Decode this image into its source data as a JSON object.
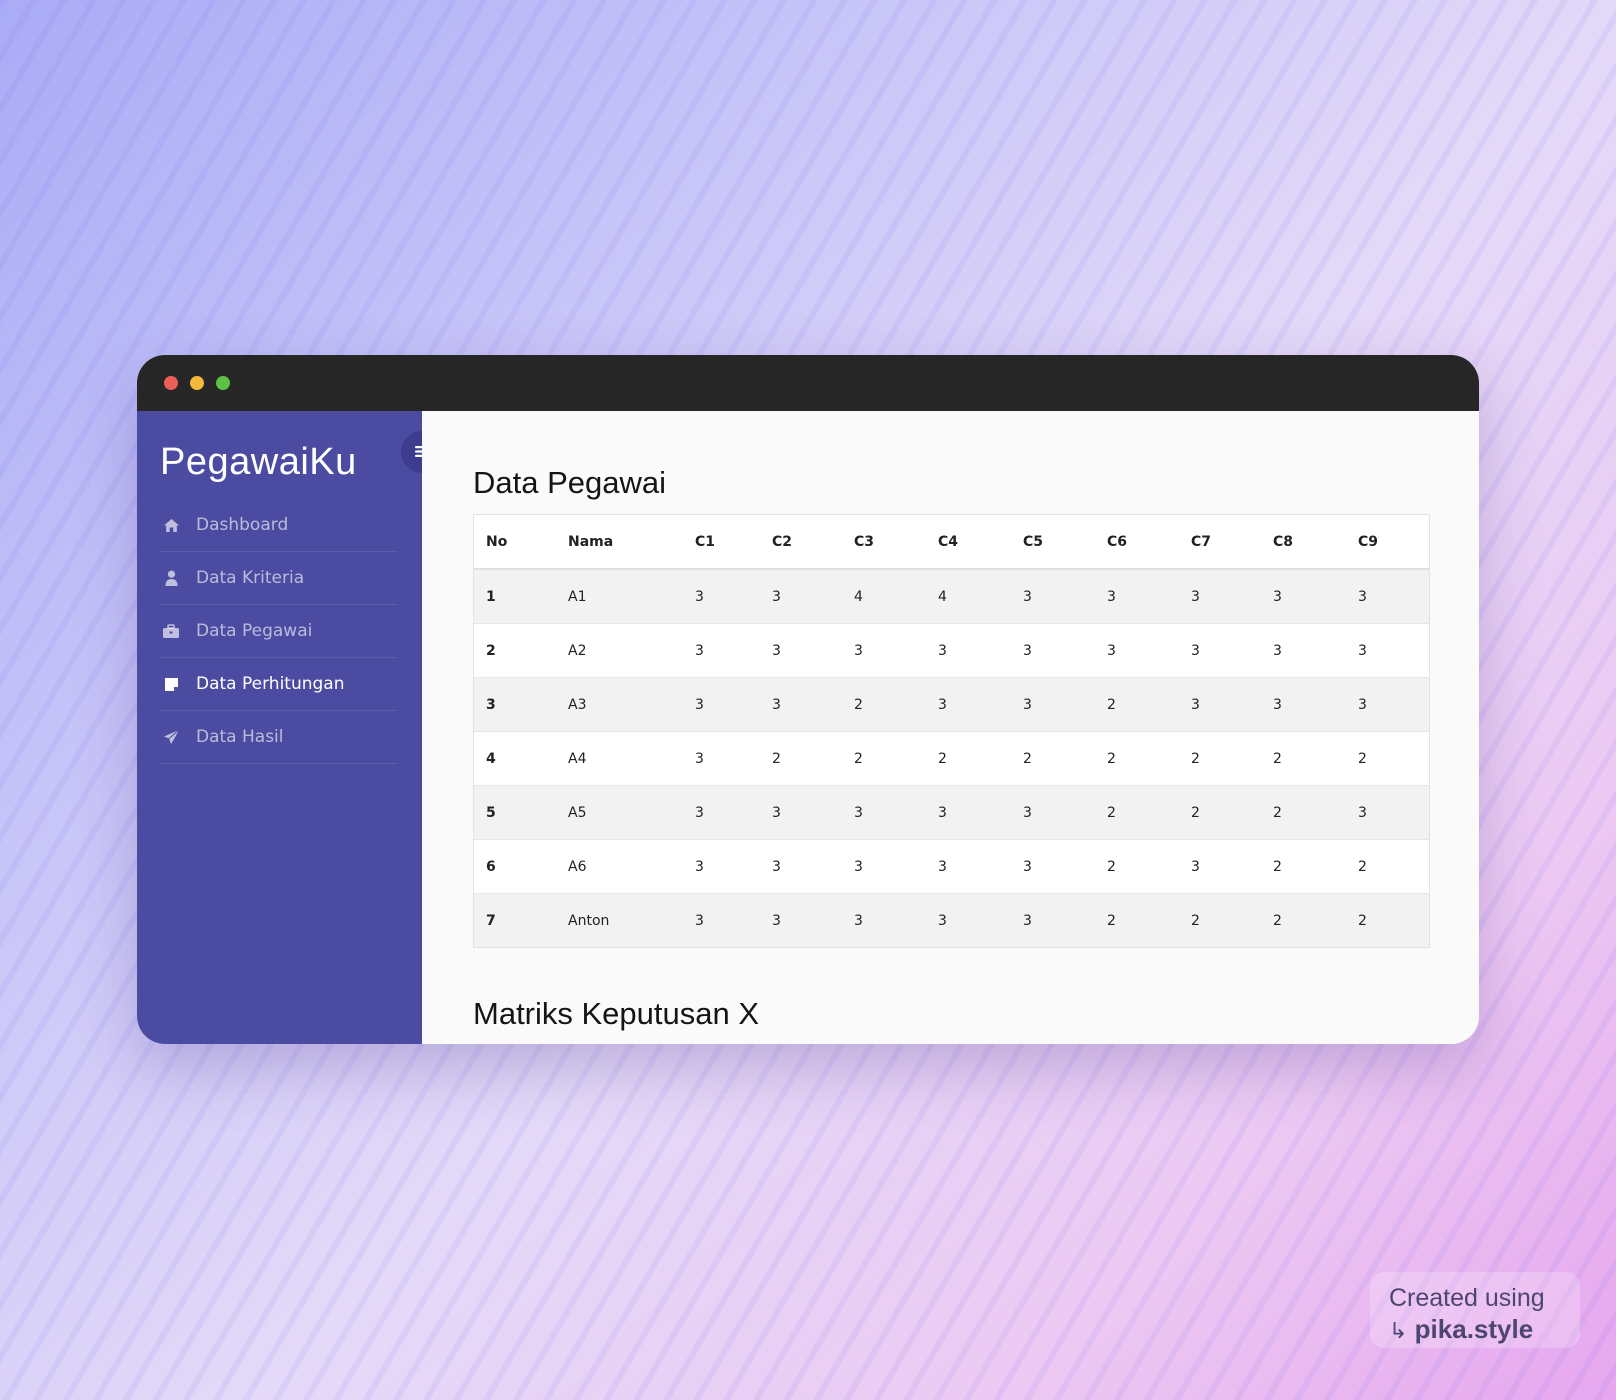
{
  "app": {
    "brand": "PegawaiKu"
  },
  "sidebar": {
    "items": [
      {
        "label": "Dashboard",
        "icon": "home-icon"
      },
      {
        "label": "Data Kriteria",
        "icon": "user-icon"
      },
      {
        "label": "Data Pegawai",
        "icon": "briefcase-icon"
      },
      {
        "label": "Data Perhitungan",
        "icon": "note-icon",
        "active": true
      },
      {
        "label": "Data Hasil",
        "icon": "paper-plane-icon"
      }
    ]
  },
  "main": {
    "section1_title": "Data Pegawai",
    "section2_title": "Matriks Keputusan X",
    "table": {
      "headers": [
        "No",
        "Nama",
        "C1",
        "C2",
        "C3",
        "C4",
        "C5",
        "C6",
        "C7",
        "C8",
        "C9"
      ],
      "rows": [
        [
          "1",
          "A1",
          "3",
          "3",
          "4",
          "4",
          "3",
          "3",
          "3",
          "3",
          "3"
        ],
        [
          "2",
          "A2",
          "3",
          "3",
          "3",
          "3",
          "3",
          "3",
          "3",
          "3",
          "3"
        ],
        [
          "3",
          "A3",
          "3",
          "3",
          "2",
          "3",
          "3",
          "2",
          "3",
          "3",
          "3"
        ],
        [
          "4",
          "A4",
          "3",
          "2",
          "2",
          "2",
          "2",
          "2",
          "2",
          "2",
          "2"
        ],
        [
          "5",
          "A5",
          "3",
          "3",
          "3",
          "3",
          "3",
          "2",
          "2",
          "2",
          "3"
        ],
        [
          "6",
          "A6",
          "3",
          "3",
          "3",
          "3",
          "3",
          "2",
          "3",
          "2",
          "2"
        ],
        [
          "7",
          "Anton",
          "3",
          "3",
          "3",
          "3",
          "3",
          "2",
          "2",
          "2",
          "2"
        ]
      ]
    }
  },
  "watermark": {
    "line1": "Created using",
    "line2": "pika.style"
  },
  "colors": {
    "sidebar": "#4a4ba1",
    "titlebar": "#262626",
    "accent_toggle": "#3c3d8f"
  }
}
